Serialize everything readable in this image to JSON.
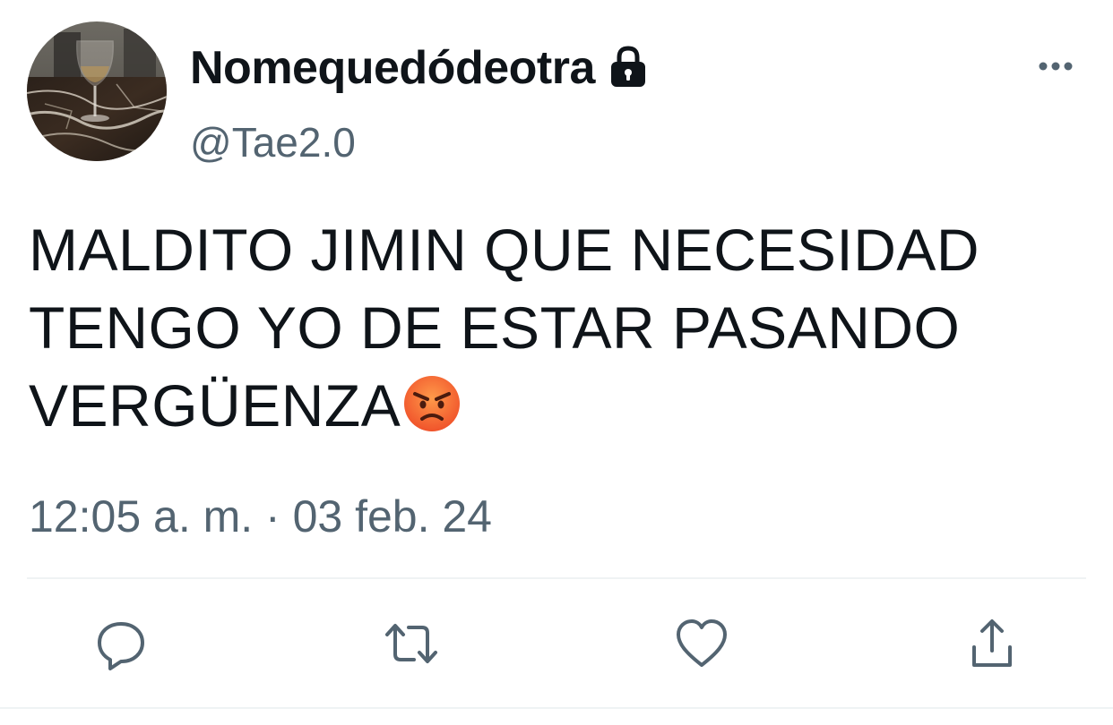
{
  "author": {
    "display_name": "Nomequedódeotra",
    "handle": "@Tae2.0",
    "avatar_icon": "wine-glass-avatar",
    "protected_icon": "lock-icon"
  },
  "tweet": {
    "lines": [
      "MALDITO JIMIN QUE NECESIDAD",
      "TENGO YO DE ESTAR PASANDO",
      "VERGÜENZA"
    ],
    "emoji": "pouting-face-emoji"
  },
  "meta": {
    "timestamp": "12:05 a. m. · 03 feb. 24"
  },
  "actions": [
    {
      "name": "reply",
      "icon": "reply-icon"
    },
    {
      "name": "retweet",
      "icon": "retweet-icon"
    },
    {
      "name": "like",
      "icon": "heart-icon"
    },
    {
      "name": "share",
      "icon": "share-icon"
    }
  ],
  "colors": {
    "text": "#0f1419",
    "secondary": "#536471",
    "divider": "#eff3f4"
  }
}
